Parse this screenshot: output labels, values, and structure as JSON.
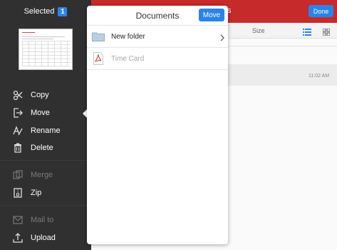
{
  "sidebar": {
    "selected_label": "Selected",
    "selected_count": "1",
    "items": [
      {
        "label": "Copy",
        "icon": "copy-icon",
        "enabled": true
      },
      {
        "label": "Move",
        "icon": "move-icon",
        "enabled": true
      },
      {
        "label": "Rename",
        "icon": "rename-icon",
        "enabled": true
      },
      {
        "label": "Delete",
        "icon": "trash-icon",
        "enabled": true
      },
      {
        "label": "Merge",
        "icon": "merge-icon",
        "enabled": false
      },
      {
        "label": "Zip",
        "icon": "zip-icon",
        "enabled": true
      },
      {
        "label": "Mail to",
        "icon": "mail-icon",
        "enabled": false
      },
      {
        "label": "Upload",
        "icon": "upload-icon",
        "enabled": true
      }
    ]
  },
  "background": {
    "title_fragment": "ts",
    "done_label": "Done",
    "size_header": "Size",
    "row_time": "11:02 AM"
  },
  "popover": {
    "title": "Documents",
    "move_label": "Move",
    "rows": [
      {
        "label": "New folder",
        "icon": "folder-icon",
        "enabled": true
      },
      {
        "label": "Time Card",
        "icon": "pdf-icon",
        "enabled": false
      }
    ]
  },
  "colors": {
    "accent": "#2a83e8",
    "header_red": "#c62a2a",
    "sidebar_bg": "#303030"
  }
}
